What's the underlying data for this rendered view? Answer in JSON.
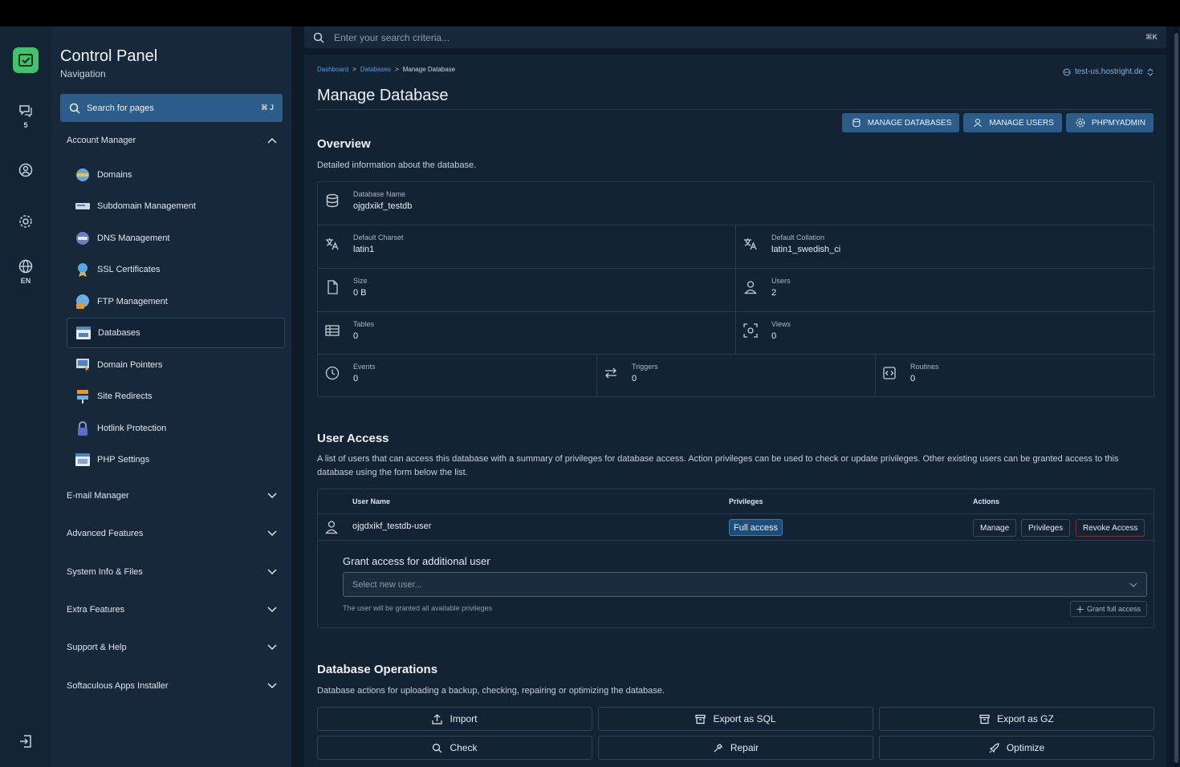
{
  "rail": {
    "chat_count": "5",
    "lang": "EN"
  },
  "sidebar": {
    "title": "Control Panel",
    "subtitle": "Navigation",
    "search_label": "Search for pages",
    "search_kbd": "⌘ J",
    "account_manager": "Account Manager",
    "items": [
      {
        "label": "Domains",
        "icon": "domains-icon"
      },
      {
        "label": "Subdomain Management",
        "icon": "subdomain-icon"
      },
      {
        "label": "DNS Management",
        "icon": "dns-icon"
      },
      {
        "label": "SSL Certificates",
        "icon": "ssl-icon"
      },
      {
        "label": "FTP Management",
        "icon": "ftp-icon"
      },
      {
        "label": "Databases",
        "icon": "sql-icon"
      },
      {
        "label": "Domain Pointers",
        "icon": "pointer-icon"
      },
      {
        "label": "Site Redirects",
        "icon": "redirect-icon"
      },
      {
        "label": "Hotlink Protection",
        "icon": "lock-icon"
      },
      {
        "label": "PHP Settings",
        "icon": "php-icon"
      }
    ],
    "sections": [
      "E-mail Manager",
      "Advanced Features",
      "System Info & Files",
      "Extra Features",
      "Support & Help",
      "Softaculous Apps Installer"
    ]
  },
  "search": {
    "placeholder": "Enter your search criteria...",
    "kbd": "⌘K"
  },
  "breadcrumb": {
    "dashboard": "Dashboard",
    "databases": "Databases",
    "current": "Manage Database",
    "sep": ">"
  },
  "host": "test-us.hostright.de",
  "page_title": "Manage Database",
  "buttons": {
    "manage_databases": "MANAGE DATABASES",
    "manage_users": "MANAGE USERS",
    "phpmyadmin": "PHPMYADMIN"
  },
  "overview": {
    "title": "Overview",
    "desc": "Detailed information about the database.",
    "db_name_label": "Database Name",
    "db_name": "ojgdxikf_testdb",
    "charset_label": "Default Charset",
    "charset": "latin1",
    "collation_label": "Default Collation",
    "collation": "latin1_swedish_ci",
    "size_label": "Size",
    "size": "0 B",
    "users_label": "Users",
    "users": "2",
    "tables_label": "Tables",
    "tables": "0",
    "views_label": "Views",
    "views": "0",
    "events_label": "Events",
    "events": "0",
    "triggers_label": "Triggers",
    "triggers": "0",
    "routines_label": "Routines",
    "routines": "0"
  },
  "user_access": {
    "title": "User Access",
    "desc": "A list of users that can access this database with a summary of privileges for database access. Action privileges can be used to check or update privileges. Other existing users can be granted access to this database using the form below the list.",
    "col_user": "User Name",
    "col_priv": "Privileges",
    "col_actions": "Actions",
    "row_user": "ojgdxikf_testdb-user",
    "row_priv": "Full access",
    "btn_manage": "Manage",
    "btn_privileges": "Privileges",
    "btn_revoke": "Revoke Access",
    "grant_title": "Grant access for additional user",
    "select_placeholder": "Select new user...",
    "hint": "The user will be granted all available privileges",
    "grant_btn": "Grant full access"
  },
  "ops": {
    "title": "Database Operations",
    "desc": "Database actions for uploading a backup, checking, repairing or optimizing the database.",
    "import": "Import",
    "export_sql": "Export as SQL",
    "export_gz": "Export as GZ",
    "check": "Check",
    "repair": "Repair",
    "optimize": "Optimize"
  },
  "colors": {
    "accent": "#2b5c8a",
    "logo_green": "#3ec46d"
  }
}
